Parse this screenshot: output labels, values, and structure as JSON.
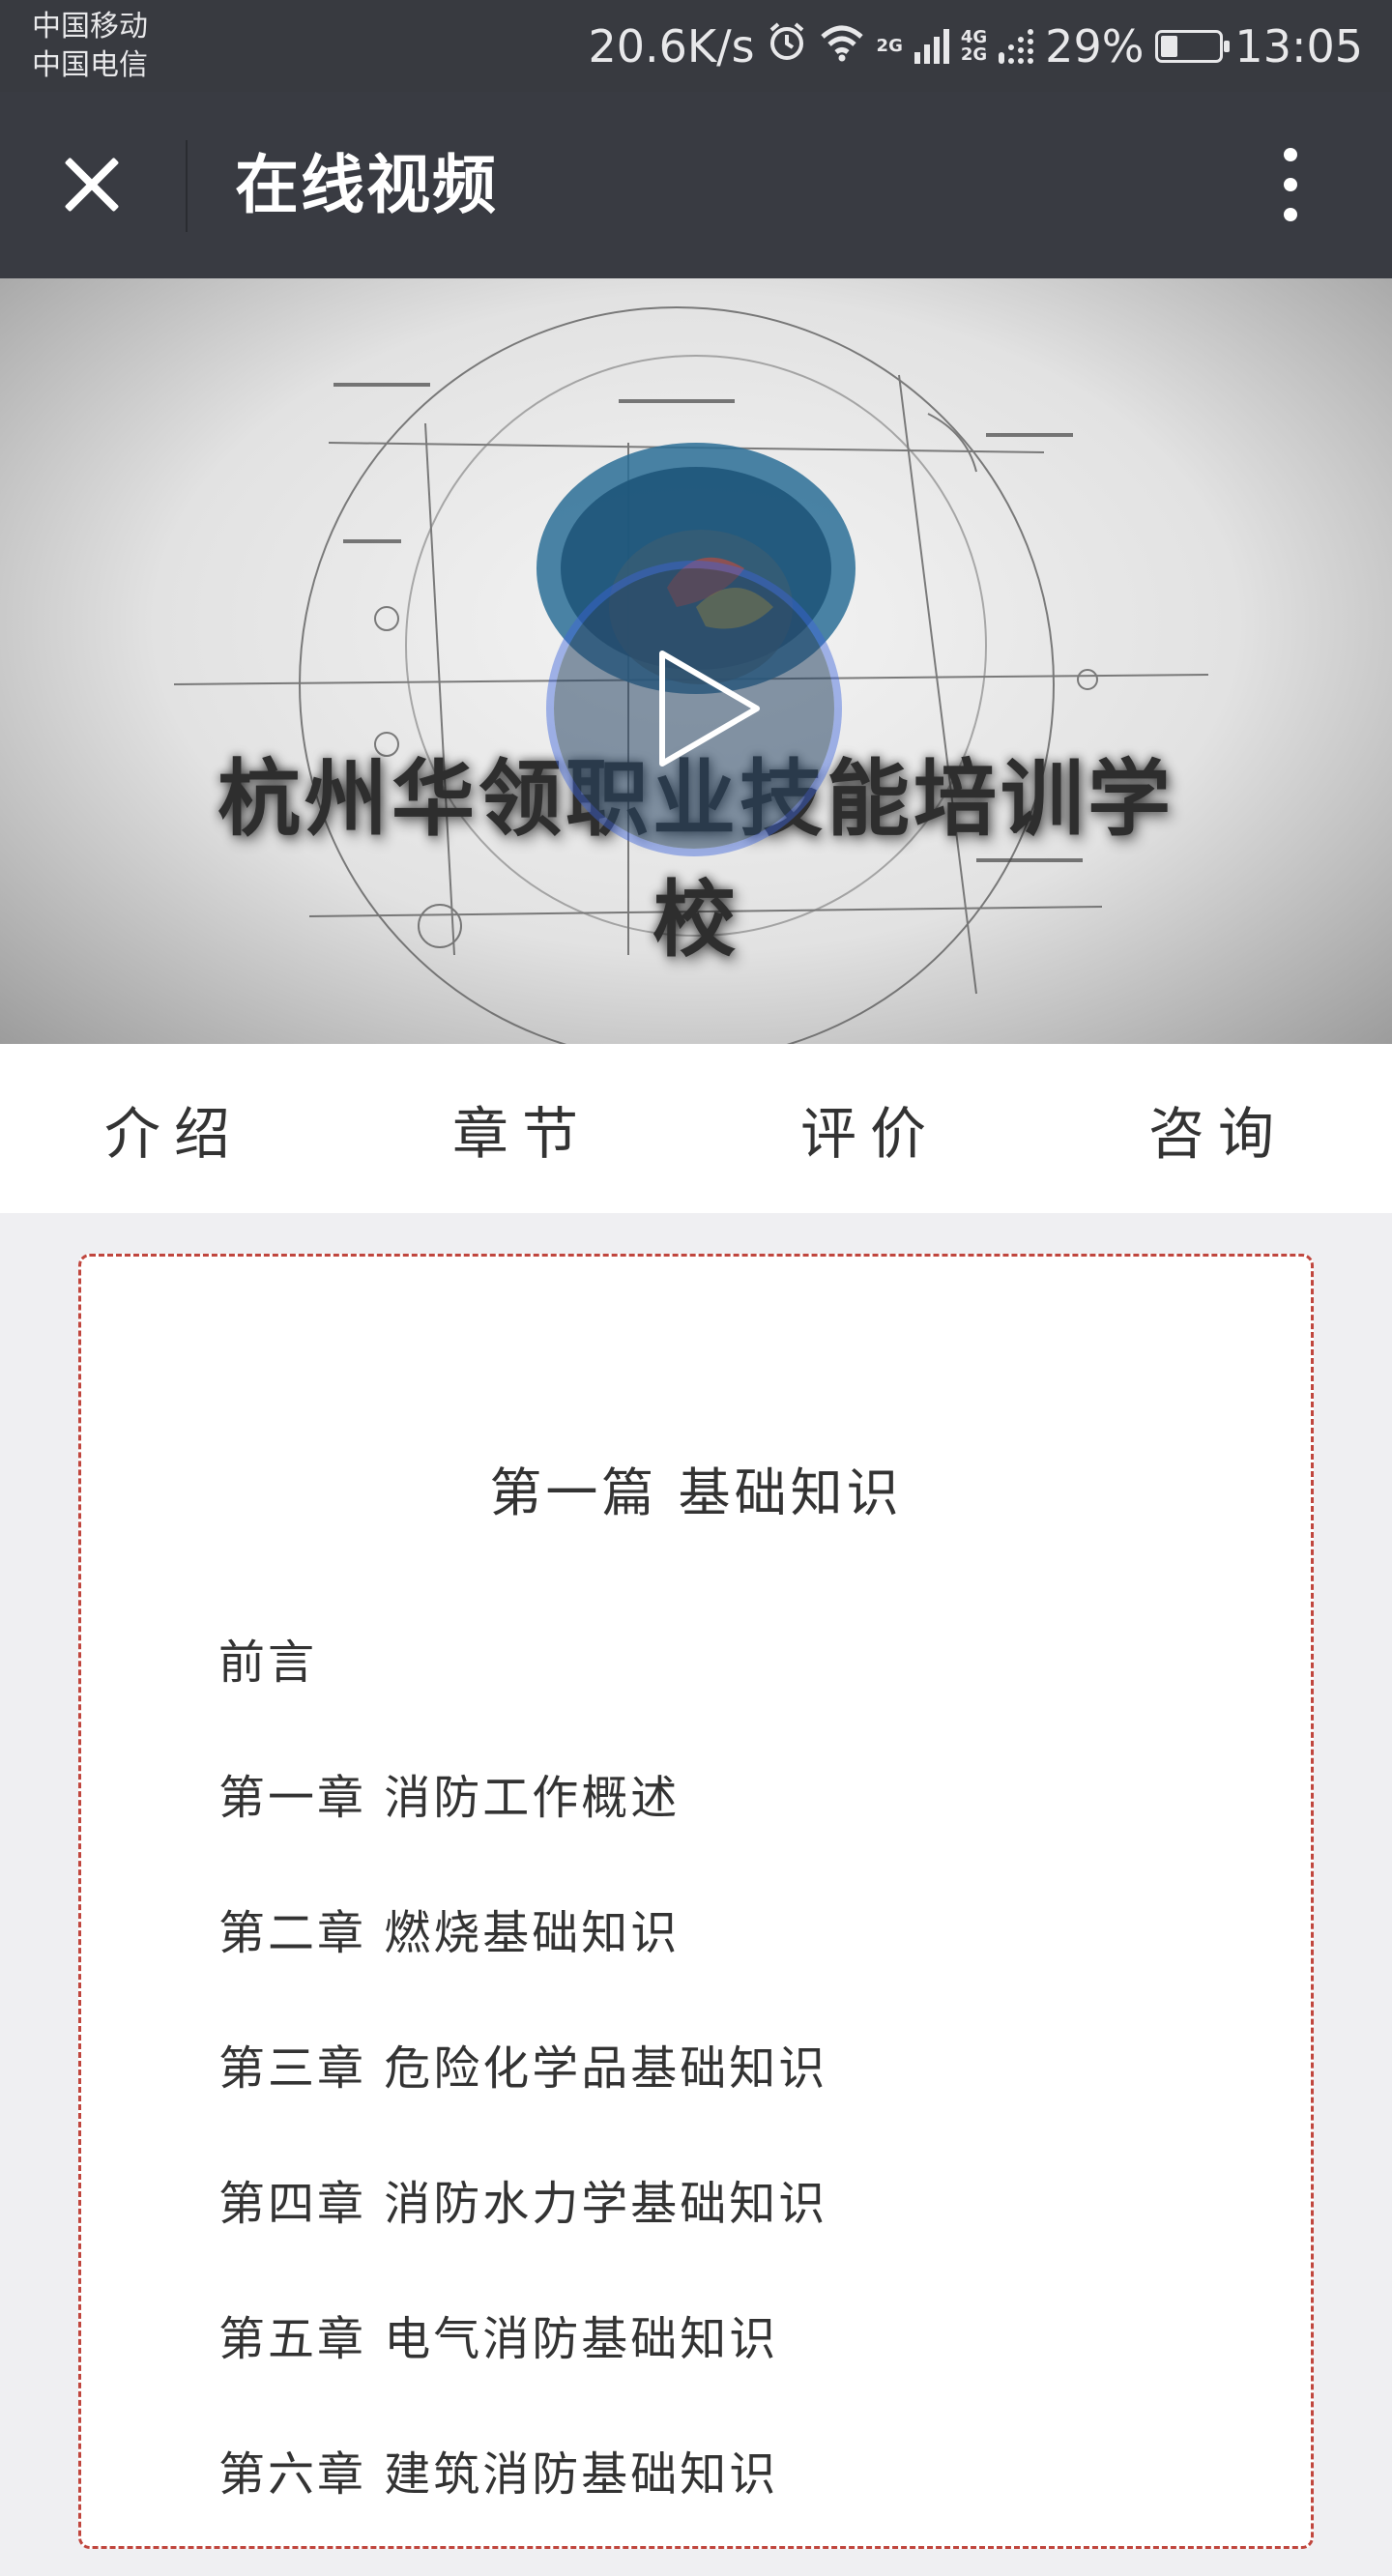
{
  "status_bar": {
    "carrier_1": "中国移动",
    "carrier_2": "中国电信",
    "speed": "20.6K/s",
    "network_tag_1": "2G",
    "network_tag_2a": "4G",
    "network_tag_2b": "2G",
    "battery_percent": "29%",
    "battery_level": 0.29,
    "time": "13:05",
    "icons": [
      "alarm-icon",
      "wifi-icon",
      "signal-icon",
      "battery-icon"
    ]
  },
  "title_bar": {
    "title": "在线视频",
    "close_icon": "close-icon",
    "more_icon": "more-vertical-icon"
  },
  "video": {
    "overlay_text": "杭州华领职业技能培训学校",
    "play_icon": "play-icon"
  },
  "tabs": [
    {
      "label": "介绍"
    },
    {
      "label": "章节"
    },
    {
      "label": "评价"
    },
    {
      "label": "咨询"
    }
  ],
  "chapters": {
    "part_title": "第一篇 基础知识",
    "items": [
      "前言",
      "第一章 消防工作概述",
      "第二章 燃烧基础知识",
      "第三章 危险化学品基础知识",
      "第四章 消防水力学基础知识",
      "第五章 电气消防基础知识",
      "第六章 建筑消防基础知识"
    ]
  },
  "colors": {
    "status_bar_bg": "#383a40",
    "title_bar_bg": "#393b42",
    "card_border": "#c0463e",
    "page_bg": "#efeff2"
  }
}
